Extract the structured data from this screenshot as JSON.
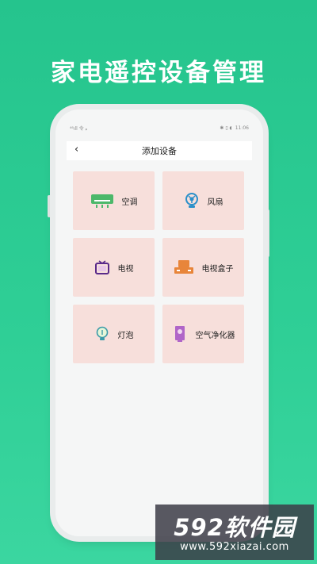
{
  "headline": "家电遥控设备管理",
  "statusbar": {
    "left": "⁴⁶ıll 令 ᵩ",
    "right_icons": "✱ ▯ ◖",
    "time": "11:06"
  },
  "titlebar": {
    "back": "‹",
    "title": "添加设备"
  },
  "devices": [
    {
      "label": "空调",
      "icon": "air-conditioner-icon",
      "color": "#4cb86a"
    },
    {
      "label": "风扇",
      "icon": "fan-icon",
      "color": "#2a8fc9"
    },
    {
      "label": "电视",
      "icon": "tv-icon",
      "color": "#5a2a8a"
    },
    {
      "label": "电视盒子",
      "icon": "tv-box-icon",
      "color": "#e8853a"
    },
    {
      "label": "灯泡",
      "icon": "light-bulb-icon",
      "color": "#3a9aa8"
    },
    {
      "label": "空气净化器",
      "icon": "air-purifier-icon",
      "color": "#b065c8"
    }
  ],
  "watermark": {
    "brand": "592软件园",
    "url": "www.592xiazai.com"
  }
}
